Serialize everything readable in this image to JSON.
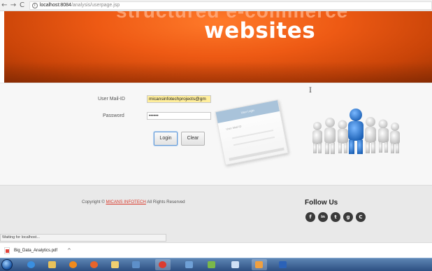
{
  "browser": {
    "url_host": "localhost:8084",
    "url_path": "/analysis/userpage.jsp"
  },
  "banner": {
    "ghost_text": "structured e-commerce",
    "headline": "websites"
  },
  "login": {
    "email_label": "User Mail-ID",
    "email_value": "micansinfotechprojects@gm",
    "password_label": "Password",
    "password_value": "••••••",
    "login_button": "Login",
    "clear_button": "Clear"
  },
  "preview_card": {
    "header": "User Login",
    "line": "User Mail-ID"
  },
  "footer": {
    "copyright_prefix": "Copyright © ",
    "brand": "MICANS INFOTECH",
    "copyright_suffix": " All Rights Reserved",
    "follow_title": "Follow Us",
    "social": [
      "f",
      "in",
      "t",
      "g",
      "C"
    ]
  },
  "status": {
    "text": "Waiting for localhost..."
  },
  "downloads": {
    "file_name": "Big_Data_Analytics.pdf",
    "chevron": "^"
  },
  "colors": {
    "banner": "#ee5a14",
    "email_autofill": "#ffee9c",
    "brand_link": "#d8392b",
    "figure_highlight": "#2a7bd6"
  }
}
